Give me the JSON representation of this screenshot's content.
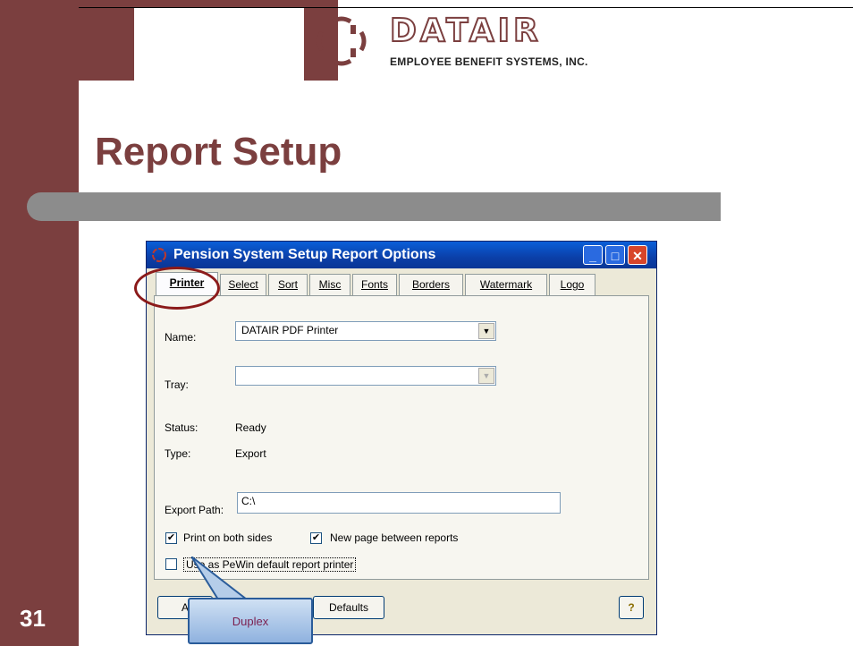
{
  "slide": {
    "title": "Report Setup",
    "page_number": "31"
  },
  "logo": {
    "wordmark": "DATAIR",
    "subtitle": "EMPLOYEE BENEFIT SYSTEMS, INC."
  },
  "window": {
    "title": "Pension System Setup Report Options",
    "controls": {
      "minimize": "_",
      "maximize": "□",
      "close": "✕"
    }
  },
  "tabs": [
    {
      "label": "Printer"
    },
    {
      "label": "Select"
    },
    {
      "label": "Sort"
    },
    {
      "label": "Misc"
    },
    {
      "label": "Fonts"
    },
    {
      "label": "Borders"
    },
    {
      "label": "Watermark"
    },
    {
      "label": "Logo"
    }
  ],
  "printer": {
    "name_label": "Name:",
    "name_value": "DATAIR PDF Printer",
    "tray_label": "Tray:",
    "tray_value": "",
    "status_label": "Status:",
    "status_value": "Ready",
    "type_label": "Type:",
    "type_value": "Export",
    "export_path_label": "Export Path:",
    "export_path_value": "C:\\",
    "print_both_sides_label": "Print on both sides",
    "new_page_label": "New page between reports",
    "default_printer_label": "Use as PeWin default report printer"
  },
  "buttons": {
    "apply_partial": "A",
    "defaults": "Defaults",
    "help_icon": "help-icon"
  },
  "callout": {
    "text": "Duplex"
  },
  "colors": {
    "accent": "#7b3f3f",
    "titlebar": "#0a5fd8",
    "title_text": "#7b3f3f"
  }
}
